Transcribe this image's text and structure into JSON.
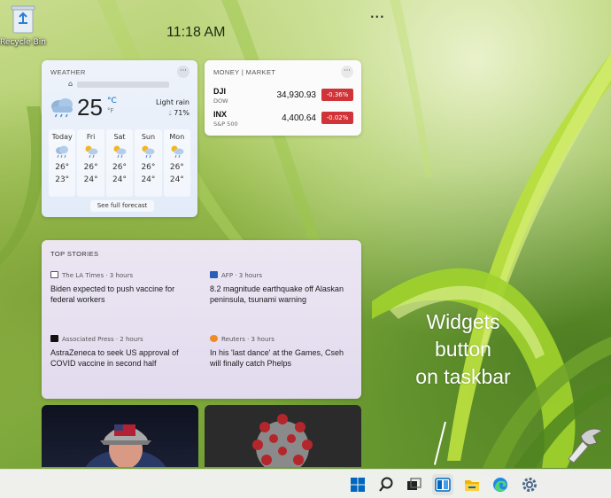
{
  "desktop": {
    "recycle_bin_label": "Recycle Bin"
  },
  "widgets_board": {
    "time": "11:18 AM",
    "more_label": "···"
  },
  "weather": {
    "title": "WEATHER",
    "temperature": "25",
    "unit_c": "°C",
    "unit_f": "°F",
    "condition": "Light rain",
    "precipitation": "71%",
    "forecast": [
      {
        "day": "Today",
        "high": "26°",
        "low": "23°",
        "icon": "cloud-rain-icon"
      },
      {
        "day": "Fri",
        "high": "26°",
        "low": "24°",
        "icon": "sun-cloud-rain-icon"
      },
      {
        "day": "Sat",
        "high": "26°",
        "low": "24°",
        "icon": "sun-cloud-rain-icon"
      },
      {
        "day": "Sun",
        "high": "26°",
        "low": "24°",
        "icon": "sun-cloud-rain-icon"
      },
      {
        "day": "Mon",
        "high": "26°",
        "low": "24°",
        "icon": "sun-cloud-rain-icon"
      }
    ],
    "link": "See full forecast"
  },
  "market": {
    "title": "MONEY | MARKET",
    "rows": [
      {
        "symbol": "DJI",
        "exchange": "DOW",
        "price": "34,930.93",
        "change": "-0.36%"
      },
      {
        "symbol": "INX",
        "exchange": "S&P 500",
        "price": "4,400.64",
        "change": "-0.02%"
      }
    ],
    "down_color": "#d13438"
  },
  "top_stories": {
    "title": "TOP STORIES",
    "items": [
      {
        "source": "The LA Times · 3 hours",
        "headline": "Biden expected to push vaccine for federal workers"
      },
      {
        "source": "AFP · 3 hours",
        "headline": "8.2 magnitude earthquake off Alaskan peninsula, tsunami warning"
      },
      {
        "source": "Associated Press · 2 hours",
        "headline": "AstraZeneca to seek US approval of COVID vaccine in second half"
      },
      {
        "source": "Reuters · 3 hours",
        "headline": "In his 'last dance' at the Games, Cseh will finally catch Phelps"
      }
    ]
  },
  "annotation": {
    "lines": [
      "Widgets",
      "button",
      "on taskbar"
    ]
  },
  "taskbar": {
    "items": [
      "start-icon",
      "search-icon",
      "task-view-icon",
      "widgets-icon",
      "file-explorer-icon",
      "edge-icon",
      "settings-icon"
    ],
    "accent_color": "#0067c0"
  }
}
